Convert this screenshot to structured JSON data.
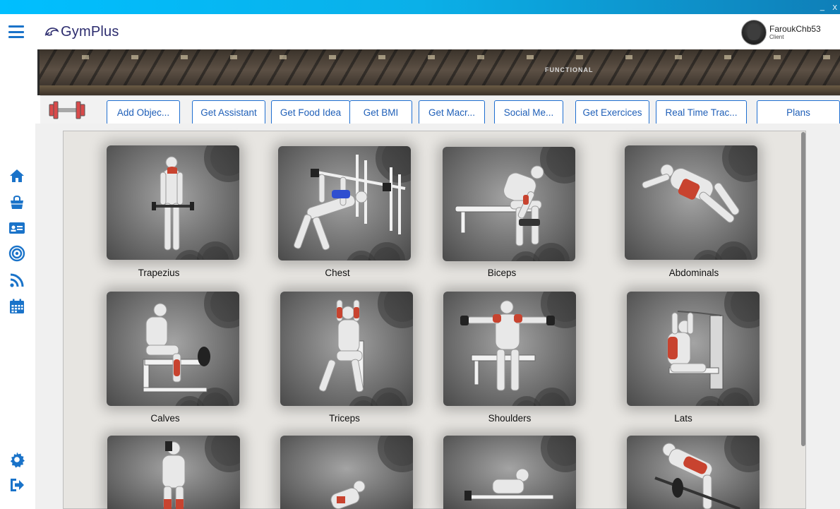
{
  "app": {
    "name": "GymPlus"
  },
  "user": {
    "username": "FaroukChb53",
    "role": "Client"
  },
  "banner": {
    "sign": "FUNCTIONAL"
  },
  "toolbar": {
    "buttons": [
      {
        "label": "Add Objec..."
      },
      {
        "label": "Get Assistant"
      },
      {
        "label": "Get Food Idea"
      },
      {
        "label": "Get BMI"
      },
      {
        "label": "Get Macr..."
      },
      {
        "label": "Social Me..."
      },
      {
        "label": "Get Exercices"
      },
      {
        "label": "Real Time Trac..."
      },
      {
        "label": "Plans"
      }
    ]
  },
  "sidebar": {
    "icons": [
      "home-icon",
      "shopping-bag-icon",
      "id-card-icon",
      "target-icon",
      "rss-feed-icon",
      "calendar-icon",
      "gear-icon",
      "sign-out-icon"
    ]
  },
  "muscles": [
    {
      "name": "Trapezius",
      "highlight": "#c8432f"
    },
    {
      "name": "Chest",
      "highlight": "#2f4fd0"
    },
    {
      "name": "Biceps",
      "highlight": "#c8432f"
    },
    {
      "name": "Abdominals",
      "highlight": "#c8432f"
    },
    {
      "name": "Calves",
      "highlight": "#c8432f"
    },
    {
      "name": "Triceps",
      "highlight": "#c8432f"
    },
    {
      "name": "Shoulders",
      "highlight": "#c8432f"
    },
    {
      "name": "Lats",
      "highlight": "#c8432f"
    }
  ],
  "colors": {
    "accent": "#1f6fd1",
    "titlebar": "#00bfff",
    "muscle_red": "#c8432f"
  }
}
